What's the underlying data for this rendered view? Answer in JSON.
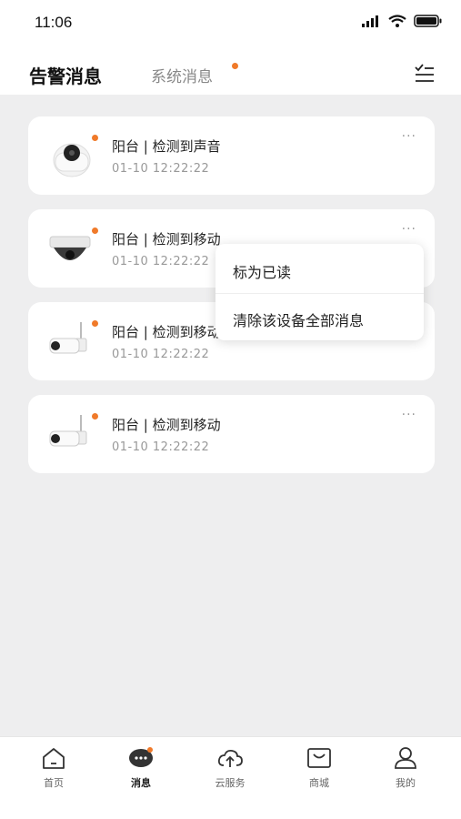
{
  "status_bar": {
    "time": "11:06"
  },
  "header": {
    "tab_alert": "告警消息",
    "tab_system": "系统消息"
  },
  "messages": [
    {
      "title": "阳台 | 检测到声音",
      "time": "01-10  12:22:22",
      "device": "dome-camera"
    },
    {
      "title": "阳台 | 检测到移动",
      "time": "01-10  12:22:22",
      "device": "ceiling-dome-camera"
    },
    {
      "title": "阳台 | 检测到移动",
      "time": "01-10  12:22:22",
      "device": "bullet-camera"
    },
    {
      "title": "阳台 | 检测到移动",
      "time": "01-10  12:22:22",
      "device": "bullet-camera"
    }
  ],
  "more_label": "···",
  "popup": {
    "mark_read": "标为已读",
    "clear_device": "清除该设备全部消息"
  },
  "tabbar": [
    {
      "label": "首页",
      "icon": "home-icon"
    },
    {
      "label": "消息",
      "icon": "message-icon"
    },
    {
      "label": "云服务",
      "icon": "cloud-icon"
    },
    {
      "label": "商城",
      "icon": "shop-icon"
    },
    {
      "label": "我的",
      "icon": "profile-icon"
    }
  ],
  "colors": {
    "accent_dot": "#f07a2a",
    "background": "#eeeeef"
  }
}
